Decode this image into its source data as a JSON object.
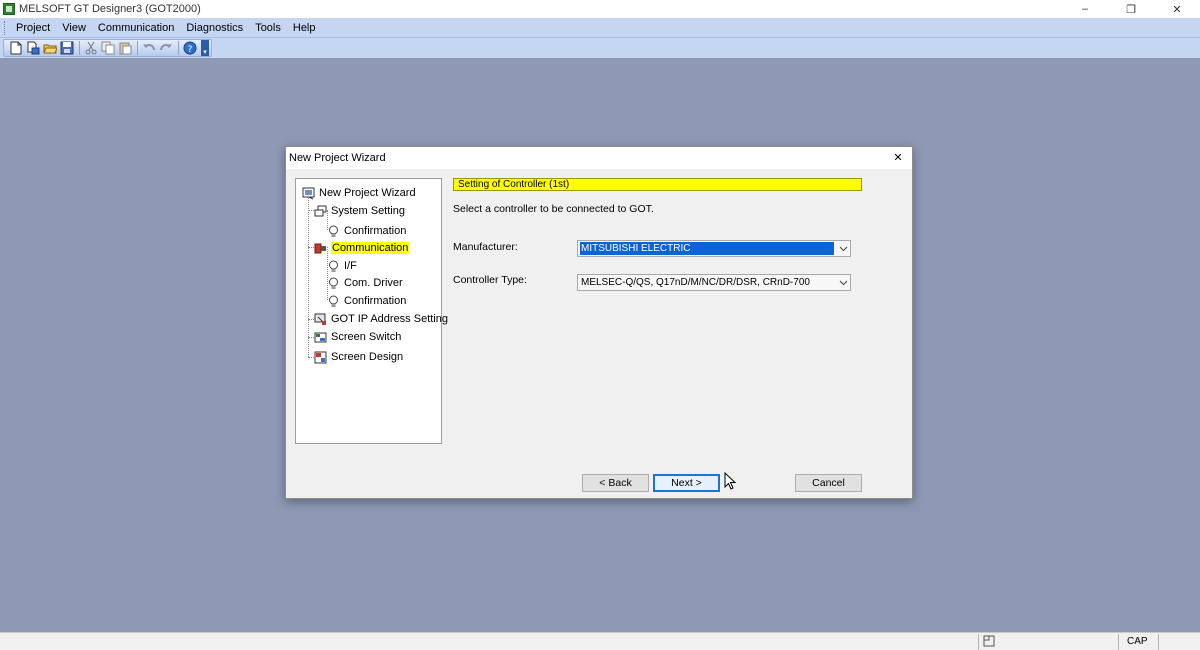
{
  "app": {
    "title": "MELSOFT GT Designer3 (GOT2000)",
    "window_controls": {
      "minimize": "–",
      "restore": "❐",
      "close": "✕"
    }
  },
  "menubar": {
    "items": [
      "Project",
      "View",
      "Communication",
      "Diagnostics",
      "Tools",
      "Help"
    ]
  },
  "toolbar": {
    "icons": [
      "new-icon",
      "open-icon",
      "open-folder-icon",
      "save-icon",
      "cut-icon",
      "copy-icon",
      "paste-icon",
      "undo-icon",
      "redo-icon",
      "help-icon"
    ]
  },
  "statusbar": {
    "cap": "CAP"
  },
  "dialog": {
    "title": "New Project Wizard",
    "close": "✕",
    "tree": [
      {
        "label": "New Project Wizard",
        "icon": "wizard-icon"
      },
      {
        "label": "System Setting",
        "icon": "system-setting-icon"
      },
      {
        "label": "Confirmation",
        "icon": "lightbulb-icon"
      },
      {
        "label": "Communication",
        "icon": "communication-icon",
        "selected": true
      },
      {
        "label": "I/F",
        "icon": "lightbulb-icon"
      },
      {
        "label": "Com. Driver",
        "icon": "lightbulb-icon"
      },
      {
        "label": "Confirmation",
        "icon": "lightbulb-icon"
      },
      {
        "label": "GOT IP Address Setting",
        "icon": "ip-address-icon"
      },
      {
        "label": "Screen Switch",
        "icon": "screen-switch-icon"
      },
      {
        "label": "Screen Design",
        "icon": "screen-design-icon"
      }
    ],
    "header": "Setting of Controller (1st)",
    "instruction": "Select a controller to be connected to GOT.",
    "manufacturer": {
      "label": "Manufacturer:",
      "value": "MITSUBISHI ELECTRIC"
    },
    "controller_type": {
      "label": "Controller Type:",
      "value": "MELSEC-Q/QS, Q17nD/M/NC/DR/DSR, CRnD-700"
    },
    "buttons": {
      "back": "< Back",
      "next": "Next >",
      "cancel": "Cancel"
    }
  },
  "colors": {
    "workspace": "#8e9ab5",
    "menubar": "#c5d6f3",
    "highlight_yellow": "#ffff00",
    "selection_blue": "#0a64d8"
  }
}
